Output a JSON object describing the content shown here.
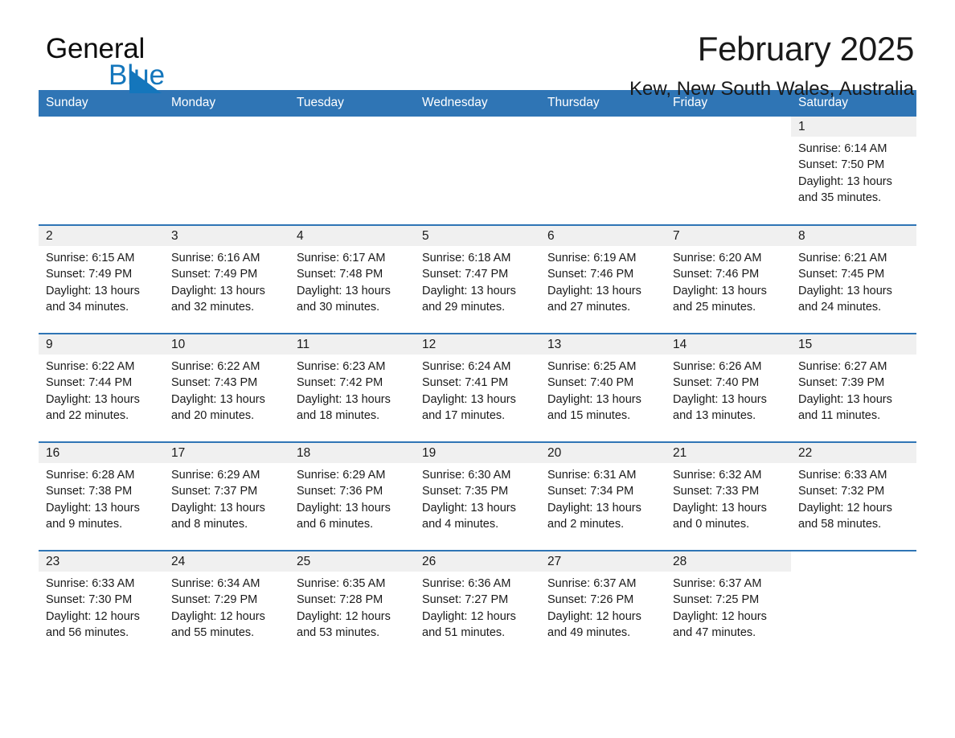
{
  "brand": {
    "name_line1": "General",
    "name_line2": "Blue",
    "triangle_color": "#1476bc"
  },
  "header": {
    "title": "February 2025",
    "subtitle": "Kew, New South Wales, Australia"
  },
  "colors": {
    "header_blue": "#2f75b5",
    "daynum_band": "#f0f0f0",
    "text": "#1a1a1a"
  },
  "weekday_headers": [
    "Sunday",
    "Monday",
    "Tuesday",
    "Wednesday",
    "Thursday",
    "Friday",
    "Saturday"
  ],
  "weeks": [
    [
      {
        "day": "",
        "lines": []
      },
      {
        "day": "",
        "lines": []
      },
      {
        "day": "",
        "lines": []
      },
      {
        "day": "",
        "lines": []
      },
      {
        "day": "",
        "lines": []
      },
      {
        "day": "",
        "lines": []
      },
      {
        "day": "1",
        "lines": [
          "Sunrise: 6:14 AM",
          "Sunset: 7:50 PM",
          "Daylight: 13 hours",
          "and 35 minutes."
        ]
      }
    ],
    [
      {
        "day": "2",
        "lines": [
          "Sunrise: 6:15 AM",
          "Sunset: 7:49 PM",
          "Daylight: 13 hours",
          "and 34 minutes."
        ]
      },
      {
        "day": "3",
        "lines": [
          "Sunrise: 6:16 AM",
          "Sunset: 7:49 PM",
          "Daylight: 13 hours",
          "and 32 minutes."
        ]
      },
      {
        "day": "4",
        "lines": [
          "Sunrise: 6:17 AM",
          "Sunset: 7:48 PM",
          "Daylight: 13 hours",
          "and 30 minutes."
        ]
      },
      {
        "day": "5",
        "lines": [
          "Sunrise: 6:18 AM",
          "Sunset: 7:47 PM",
          "Daylight: 13 hours",
          "and 29 minutes."
        ]
      },
      {
        "day": "6",
        "lines": [
          "Sunrise: 6:19 AM",
          "Sunset: 7:46 PM",
          "Daylight: 13 hours",
          "and 27 minutes."
        ]
      },
      {
        "day": "7",
        "lines": [
          "Sunrise: 6:20 AM",
          "Sunset: 7:46 PM",
          "Daylight: 13 hours",
          "and 25 minutes."
        ]
      },
      {
        "day": "8",
        "lines": [
          "Sunrise: 6:21 AM",
          "Sunset: 7:45 PM",
          "Daylight: 13 hours",
          "and 24 minutes."
        ]
      }
    ],
    [
      {
        "day": "9",
        "lines": [
          "Sunrise: 6:22 AM",
          "Sunset: 7:44 PM",
          "Daylight: 13 hours",
          "and 22 minutes."
        ]
      },
      {
        "day": "10",
        "lines": [
          "Sunrise: 6:22 AM",
          "Sunset: 7:43 PM",
          "Daylight: 13 hours",
          "and 20 minutes."
        ]
      },
      {
        "day": "11",
        "lines": [
          "Sunrise: 6:23 AM",
          "Sunset: 7:42 PM",
          "Daylight: 13 hours",
          "and 18 minutes."
        ]
      },
      {
        "day": "12",
        "lines": [
          "Sunrise: 6:24 AM",
          "Sunset: 7:41 PM",
          "Daylight: 13 hours",
          "and 17 minutes."
        ]
      },
      {
        "day": "13",
        "lines": [
          "Sunrise: 6:25 AM",
          "Sunset: 7:40 PM",
          "Daylight: 13 hours",
          "and 15 minutes."
        ]
      },
      {
        "day": "14",
        "lines": [
          "Sunrise: 6:26 AM",
          "Sunset: 7:40 PM",
          "Daylight: 13 hours",
          "and 13 minutes."
        ]
      },
      {
        "day": "15",
        "lines": [
          "Sunrise: 6:27 AM",
          "Sunset: 7:39 PM",
          "Daylight: 13 hours",
          "and 11 minutes."
        ]
      }
    ],
    [
      {
        "day": "16",
        "lines": [
          "Sunrise: 6:28 AM",
          "Sunset: 7:38 PM",
          "Daylight: 13 hours",
          "and 9 minutes."
        ]
      },
      {
        "day": "17",
        "lines": [
          "Sunrise: 6:29 AM",
          "Sunset: 7:37 PM",
          "Daylight: 13 hours",
          "and 8 minutes."
        ]
      },
      {
        "day": "18",
        "lines": [
          "Sunrise: 6:29 AM",
          "Sunset: 7:36 PM",
          "Daylight: 13 hours",
          "and 6 minutes."
        ]
      },
      {
        "day": "19",
        "lines": [
          "Sunrise: 6:30 AM",
          "Sunset: 7:35 PM",
          "Daylight: 13 hours",
          "and 4 minutes."
        ]
      },
      {
        "day": "20",
        "lines": [
          "Sunrise: 6:31 AM",
          "Sunset: 7:34 PM",
          "Daylight: 13 hours",
          "and 2 minutes."
        ]
      },
      {
        "day": "21",
        "lines": [
          "Sunrise: 6:32 AM",
          "Sunset: 7:33 PM",
          "Daylight: 13 hours",
          "and 0 minutes."
        ]
      },
      {
        "day": "22",
        "lines": [
          "Sunrise: 6:33 AM",
          "Sunset: 7:32 PM",
          "Daylight: 12 hours",
          "and 58 minutes."
        ]
      }
    ],
    [
      {
        "day": "23",
        "lines": [
          "Sunrise: 6:33 AM",
          "Sunset: 7:30 PM",
          "Daylight: 12 hours",
          "and 56 minutes."
        ]
      },
      {
        "day": "24",
        "lines": [
          "Sunrise: 6:34 AM",
          "Sunset: 7:29 PM",
          "Daylight: 12 hours",
          "and 55 minutes."
        ]
      },
      {
        "day": "25",
        "lines": [
          "Sunrise: 6:35 AM",
          "Sunset: 7:28 PM",
          "Daylight: 12 hours",
          "and 53 minutes."
        ]
      },
      {
        "day": "26",
        "lines": [
          "Sunrise: 6:36 AM",
          "Sunset: 7:27 PM",
          "Daylight: 12 hours",
          "and 51 minutes."
        ]
      },
      {
        "day": "27",
        "lines": [
          "Sunrise: 6:37 AM",
          "Sunset: 7:26 PM",
          "Daylight: 12 hours",
          "and 49 minutes."
        ]
      },
      {
        "day": "28",
        "lines": [
          "Sunrise: 6:37 AM",
          "Sunset: 7:25 PM",
          "Daylight: 12 hours",
          "and 47 minutes."
        ]
      },
      {
        "day": "",
        "lines": []
      }
    ]
  ]
}
